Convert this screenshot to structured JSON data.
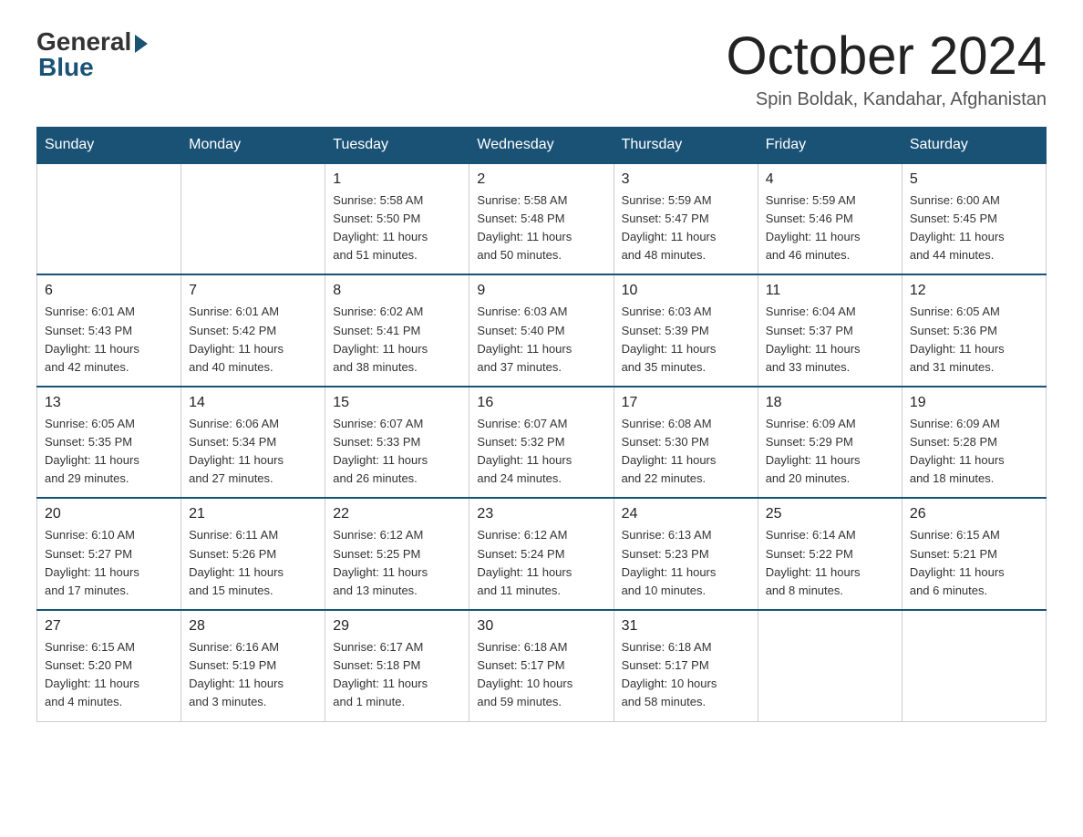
{
  "logo": {
    "general": "General",
    "blue": "Blue"
  },
  "header": {
    "month": "October 2024",
    "location": "Spin Boldak, Kandahar, Afghanistan"
  },
  "weekdays": [
    "Sunday",
    "Monday",
    "Tuesday",
    "Wednesday",
    "Thursday",
    "Friday",
    "Saturday"
  ],
  "weeks": [
    [
      {
        "day": "",
        "info": ""
      },
      {
        "day": "",
        "info": ""
      },
      {
        "day": "1",
        "info": "Sunrise: 5:58 AM\nSunset: 5:50 PM\nDaylight: 11 hours\nand 51 minutes."
      },
      {
        "day": "2",
        "info": "Sunrise: 5:58 AM\nSunset: 5:48 PM\nDaylight: 11 hours\nand 50 minutes."
      },
      {
        "day": "3",
        "info": "Sunrise: 5:59 AM\nSunset: 5:47 PM\nDaylight: 11 hours\nand 48 minutes."
      },
      {
        "day": "4",
        "info": "Sunrise: 5:59 AM\nSunset: 5:46 PM\nDaylight: 11 hours\nand 46 minutes."
      },
      {
        "day": "5",
        "info": "Sunrise: 6:00 AM\nSunset: 5:45 PM\nDaylight: 11 hours\nand 44 minutes."
      }
    ],
    [
      {
        "day": "6",
        "info": "Sunrise: 6:01 AM\nSunset: 5:43 PM\nDaylight: 11 hours\nand 42 minutes."
      },
      {
        "day": "7",
        "info": "Sunrise: 6:01 AM\nSunset: 5:42 PM\nDaylight: 11 hours\nand 40 minutes."
      },
      {
        "day": "8",
        "info": "Sunrise: 6:02 AM\nSunset: 5:41 PM\nDaylight: 11 hours\nand 38 minutes."
      },
      {
        "day": "9",
        "info": "Sunrise: 6:03 AM\nSunset: 5:40 PM\nDaylight: 11 hours\nand 37 minutes."
      },
      {
        "day": "10",
        "info": "Sunrise: 6:03 AM\nSunset: 5:39 PM\nDaylight: 11 hours\nand 35 minutes."
      },
      {
        "day": "11",
        "info": "Sunrise: 6:04 AM\nSunset: 5:37 PM\nDaylight: 11 hours\nand 33 minutes."
      },
      {
        "day": "12",
        "info": "Sunrise: 6:05 AM\nSunset: 5:36 PM\nDaylight: 11 hours\nand 31 minutes."
      }
    ],
    [
      {
        "day": "13",
        "info": "Sunrise: 6:05 AM\nSunset: 5:35 PM\nDaylight: 11 hours\nand 29 minutes."
      },
      {
        "day": "14",
        "info": "Sunrise: 6:06 AM\nSunset: 5:34 PM\nDaylight: 11 hours\nand 27 minutes."
      },
      {
        "day": "15",
        "info": "Sunrise: 6:07 AM\nSunset: 5:33 PM\nDaylight: 11 hours\nand 26 minutes."
      },
      {
        "day": "16",
        "info": "Sunrise: 6:07 AM\nSunset: 5:32 PM\nDaylight: 11 hours\nand 24 minutes."
      },
      {
        "day": "17",
        "info": "Sunrise: 6:08 AM\nSunset: 5:30 PM\nDaylight: 11 hours\nand 22 minutes."
      },
      {
        "day": "18",
        "info": "Sunrise: 6:09 AM\nSunset: 5:29 PM\nDaylight: 11 hours\nand 20 minutes."
      },
      {
        "day": "19",
        "info": "Sunrise: 6:09 AM\nSunset: 5:28 PM\nDaylight: 11 hours\nand 18 minutes."
      }
    ],
    [
      {
        "day": "20",
        "info": "Sunrise: 6:10 AM\nSunset: 5:27 PM\nDaylight: 11 hours\nand 17 minutes."
      },
      {
        "day": "21",
        "info": "Sunrise: 6:11 AM\nSunset: 5:26 PM\nDaylight: 11 hours\nand 15 minutes."
      },
      {
        "day": "22",
        "info": "Sunrise: 6:12 AM\nSunset: 5:25 PM\nDaylight: 11 hours\nand 13 minutes."
      },
      {
        "day": "23",
        "info": "Sunrise: 6:12 AM\nSunset: 5:24 PM\nDaylight: 11 hours\nand 11 minutes."
      },
      {
        "day": "24",
        "info": "Sunrise: 6:13 AM\nSunset: 5:23 PM\nDaylight: 11 hours\nand 10 minutes."
      },
      {
        "day": "25",
        "info": "Sunrise: 6:14 AM\nSunset: 5:22 PM\nDaylight: 11 hours\nand 8 minutes."
      },
      {
        "day": "26",
        "info": "Sunrise: 6:15 AM\nSunset: 5:21 PM\nDaylight: 11 hours\nand 6 minutes."
      }
    ],
    [
      {
        "day": "27",
        "info": "Sunrise: 6:15 AM\nSunset: 5:20 PM\nDaylight: 11 hours\nand 4 minutes."
      },
      {
        "day": "28",
        "info": "Sunrise: 6:16 AM\nSunset: 5:19 PM\nDaylight: 11 hours\nand 3 minutes."
      },
      {
        "day": "29",
        "info": "Sunrise: 6:17 AM\nSunset: 5:18 PM\nDaylight: 11 hours\nand 1 minute."
      },
      {
        "day": "30",
        "info": "Sunrise: 6:18 AM\nSunset: 5:17 PM\nDaylight: 10 hours\nand 59 minutes."
      },
      {
        "day": "31",
        "info": "Sunrise: 6:18 AM\nSunset: 5:17 PM\nDaylight: 10 hours\nand 58 minutes."
      },
      {
        "day": "",
        "info": ""
      },
      {
        "day": "",
        "info": ""
      }
    ]
  ]
}
